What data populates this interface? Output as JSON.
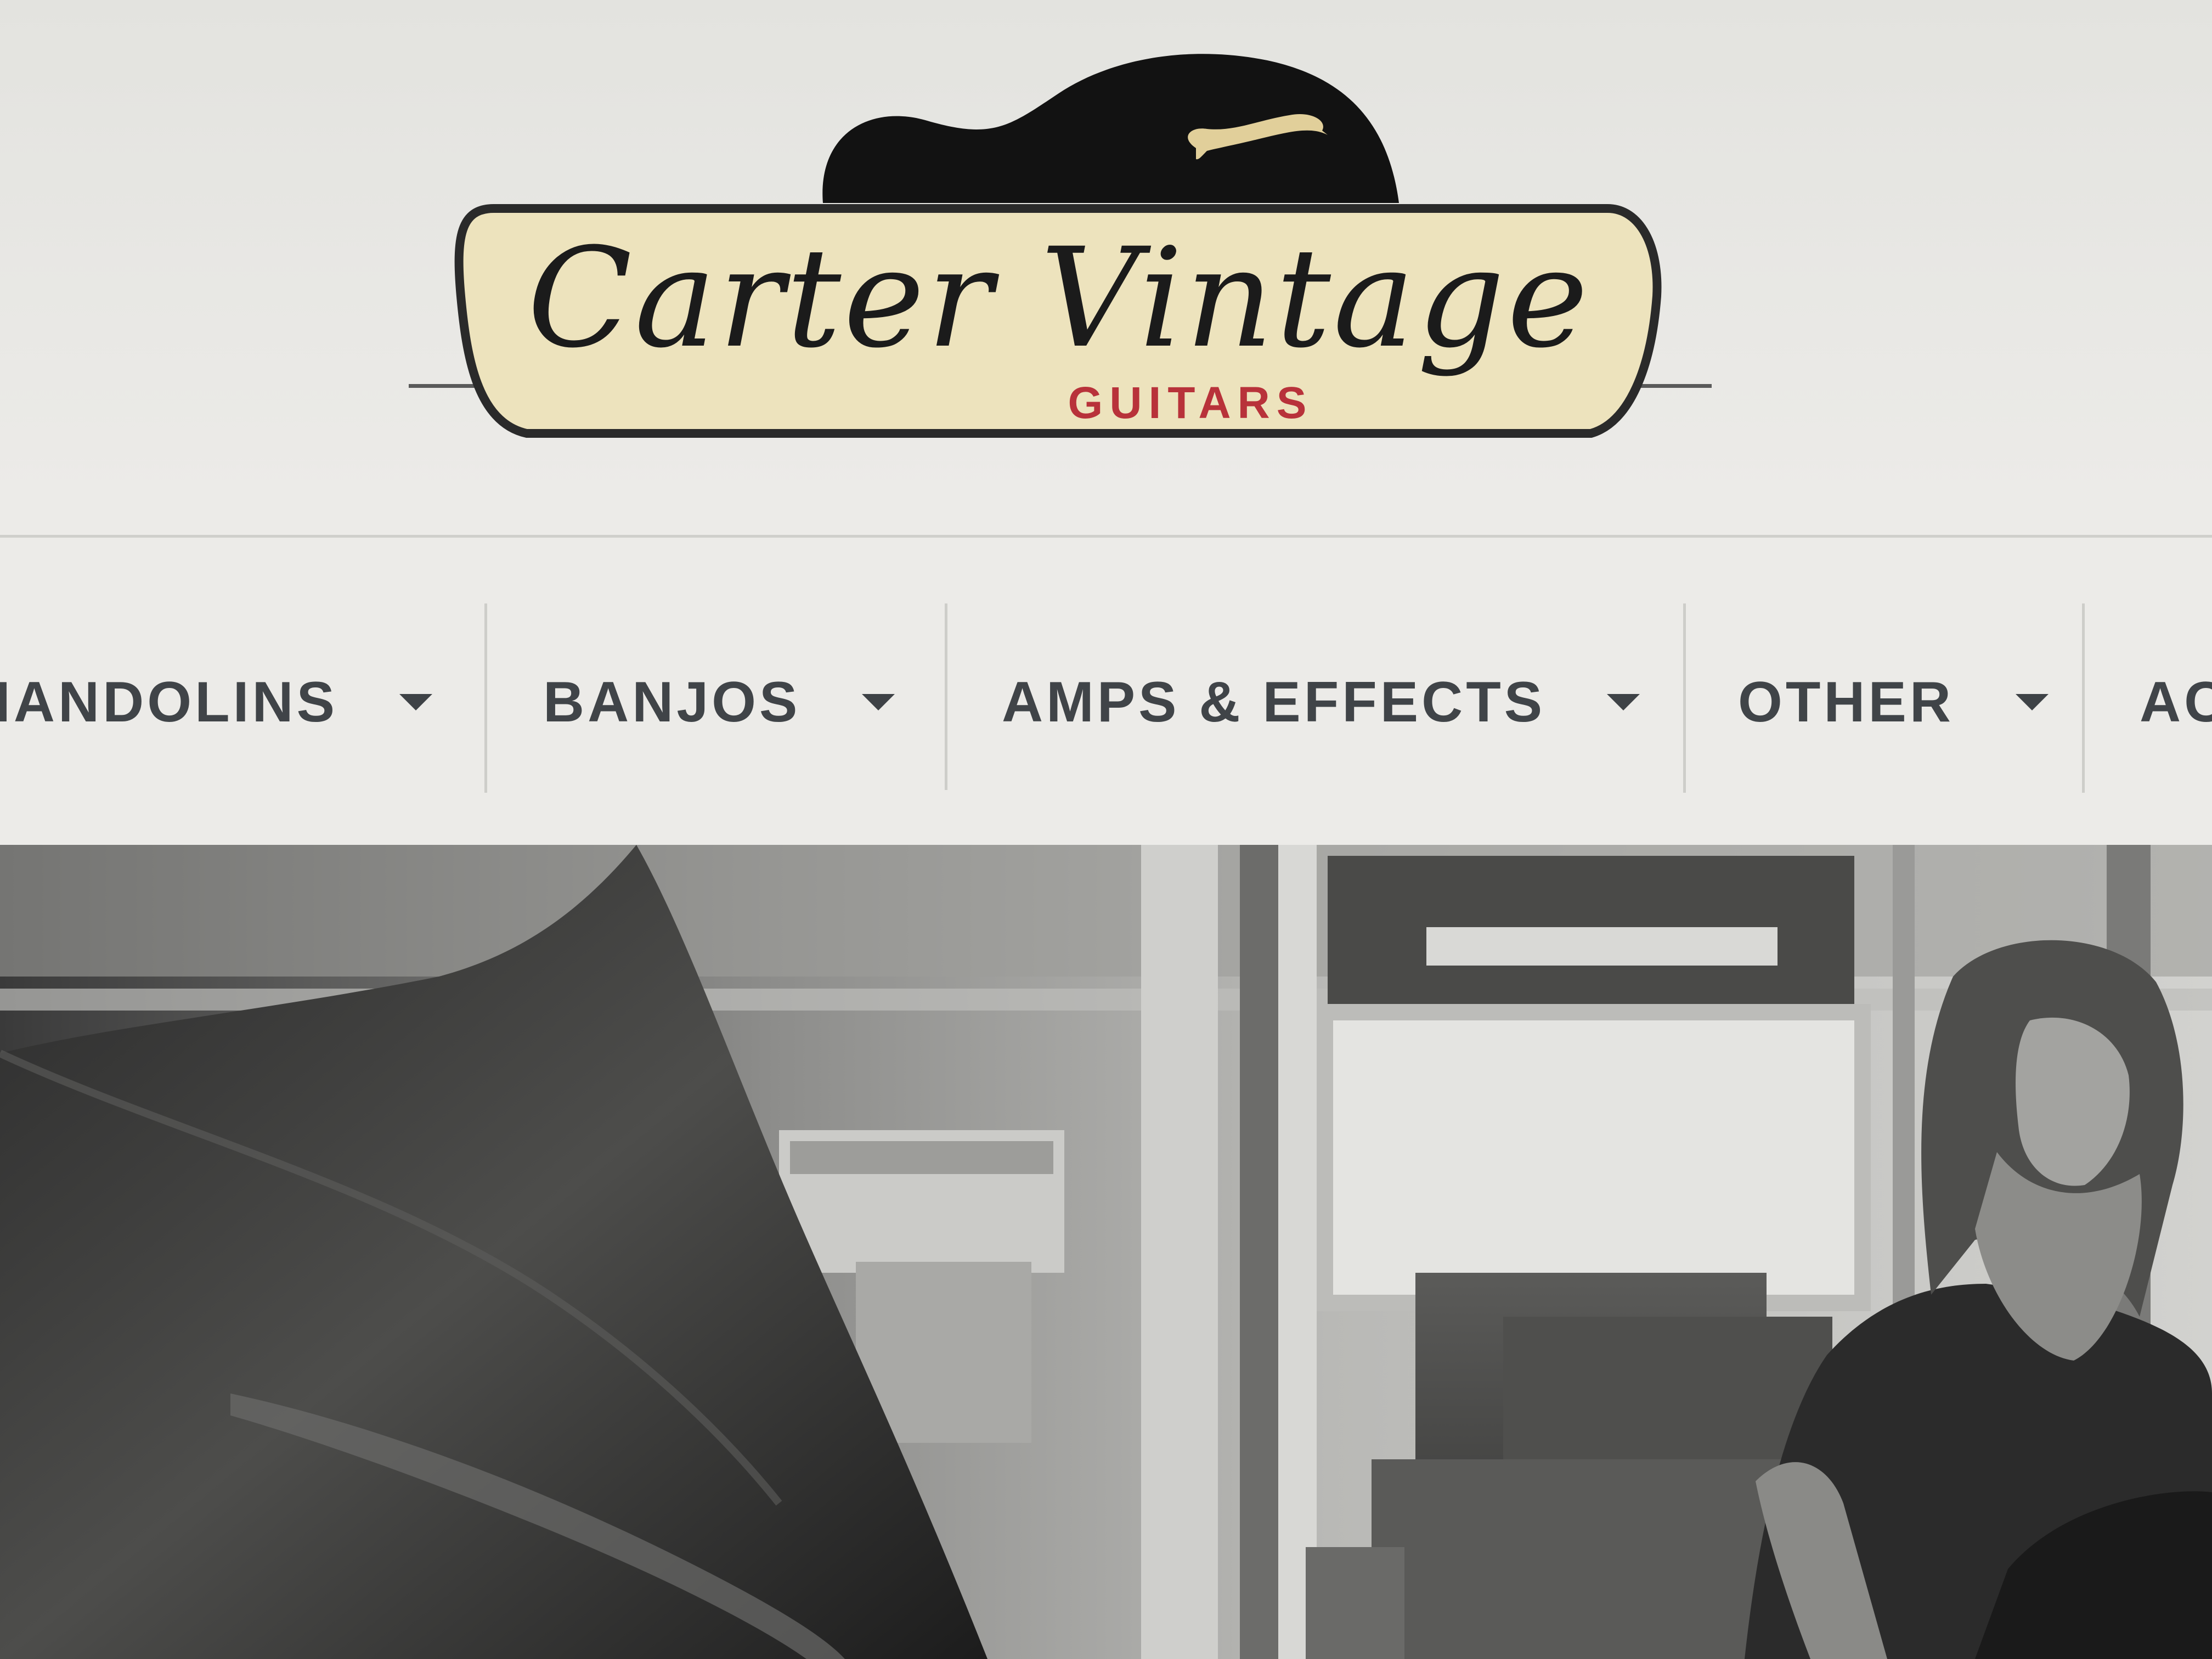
{
  "logo": {
    "script_text": "Carter Vintage",
    "sub_text": "GUITARS"
  },
  "nav": {
    "items": [
      {
        "label": "MANDOLINS",
        "visible_text": "IANDOLINS"
      },
      {
        "label": "BANJOS"
      },
      {
        "label": "AMPS & EFFECTS"
      },
      {
        "label": "OTHER"
      },
      {
        "label": "AC"
      }
    ]
  },
  "hero": {
    "image_icon": "photo-icon"
  },
  "colors": {
    "nav_text": "#404448",
    "logo_badge": "#ede3bd",
    "logo_red": "#b8323a",
    "logo_dark": "#1b1b1b",
    "page_bg": "#e9e9e6"
  }
}
